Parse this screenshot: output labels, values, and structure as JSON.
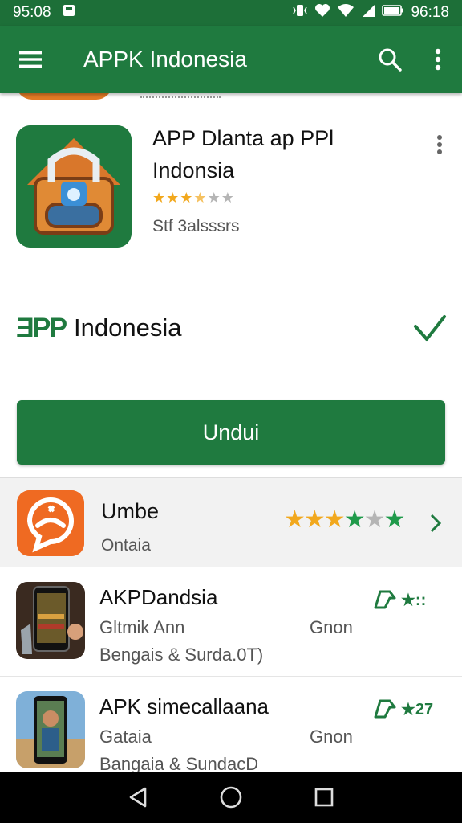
{
  "status": {
    "time_left": "95:08",
    "time_right": "96:18"
  },
  "appbar": {
    "title": "APPK Indonesia",
    "menu_icon": "menu-icon",
    "search_icon": "search-icon",
    "more_icon": "more-vert-icon"
  },
  "detail": {
    "title": "APP Dlanta ap PPl Indonsia",
    "rating_stars": "★★★★★",
    "subtitle": "Stf 3alsssrs",
    "brand_logo": "ƎPP",
    "brand_name": "Indonesia",
    "download_label": "Undui"
  },
  "featured": {
    "name": "Umbe",
    "subtitle": "Ontaia",
    "stars": "★★★★★★"
  },
  "list": [
    {
      "title": "AKPDandsia",
      "line1": "Gltmik Ann",
      "line2": "Bengais & Surda.0T)",
      "category": "Gnon",
      "badge": "★::"
    },
    {
      "title": "APK simecallaana",
      "line1": "Gataia",
      "line2": "Bangaia & SundacD",
      "category": "Gnon",
      "badge": "★27"
    }
  ],
  "colors": {
    "primary": "#1f7a3f",
    "status_bar": "#1d6f38",
    "star": "#f2a81d",
    "accent_orange": "#ef6a22"
  }
}
